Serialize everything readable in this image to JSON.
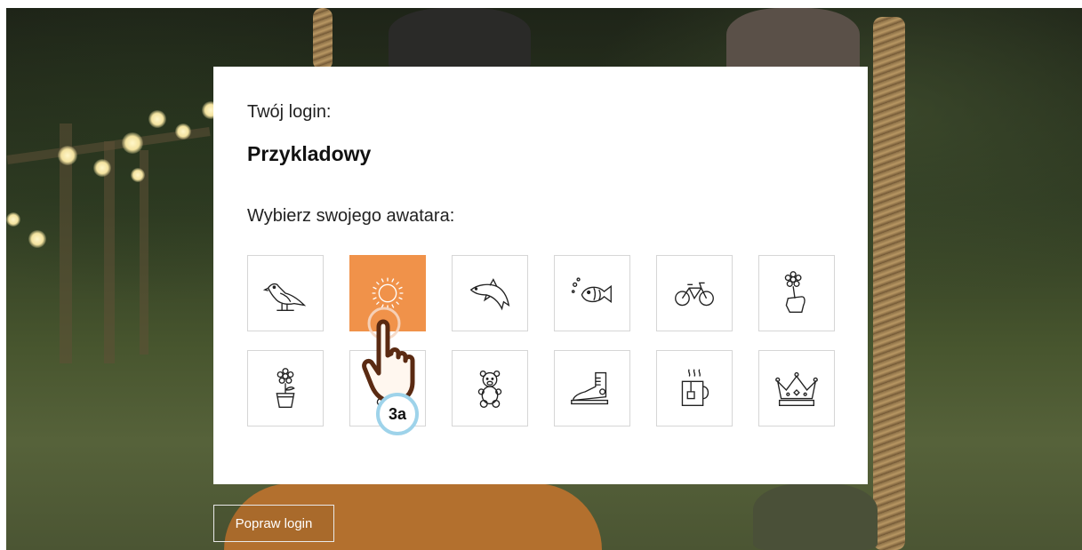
{
  "login": {
    "label": "Twój login:",
    "value": "Przykladowy"
  },
  "avatars": {
    "label": "Wybierz swojego awatara:",
    "selected": "sun",
    "items": [
      {
        "icon": "bird-icon"
      },
      {
        "icon": "sun-icon"
      },
      {
        "icon": "dolphin-icon"
      },
      {
        "icon": "fish-icon"
      },
      {
        "icon": "bicycle-icon"
      },
      {
        "icon": "flower-in-hand-icon"
      },
      {
        "icon": "potted-flower-icon"
      },
      {
        "icon": "hidden-tile-icon"
      },
      {
        "icon": "teddy-bear-icon"
      },
      {
        "icon": "sneaker-icon"
      },
      {
        "icon": "mug-icon"
      },
      {
        "icon": "crown-icon"
      }
    ],
    "selected_color": "#f0924a"
  },
  "buttons": {
    "fix_login": "Popraw login"
  },
  "annotation": {
    "step": "3a",
    "badge_ring_color": "#9ed3ea"
  }
}
